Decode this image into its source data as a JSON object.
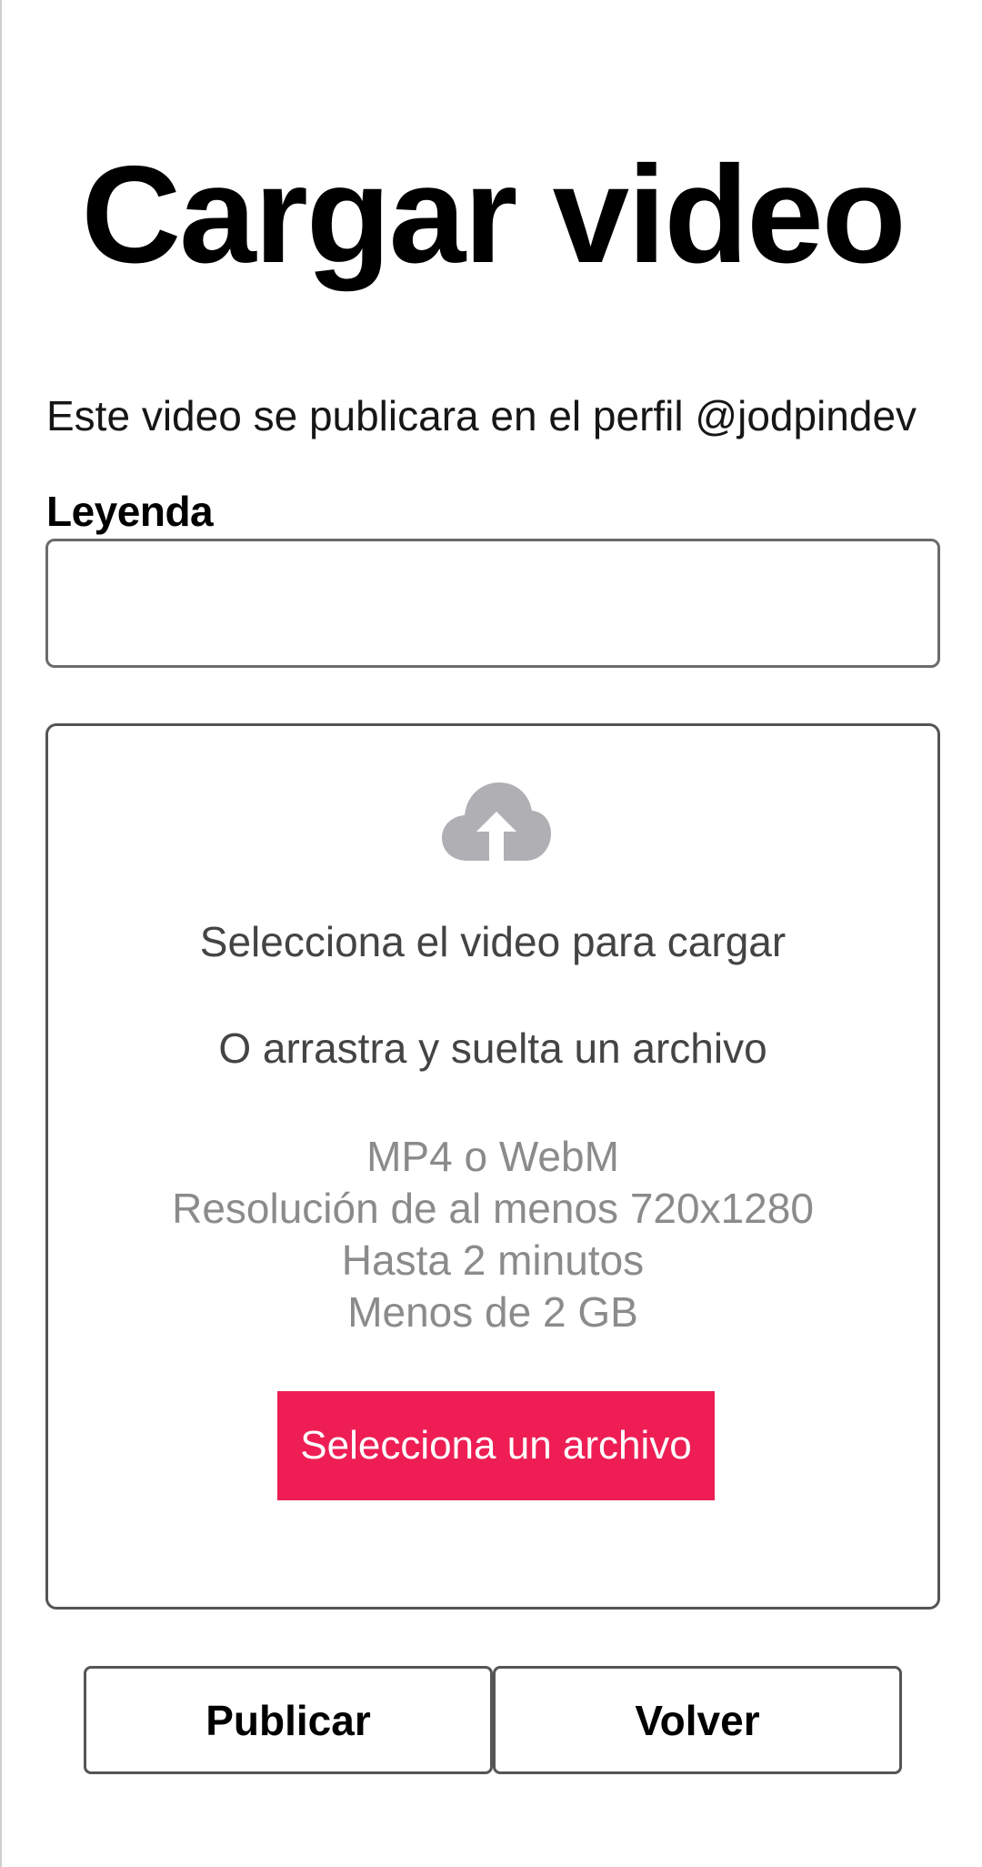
{
  "header": {
    "title": "Cargar video"
  },
  "profile_note": "Este video se publicara en el perfil @jodpindev",
  "caption": {
    "label": "Leyenda",
    "value": "",
    "placeholder": ""
  },
  "dropzone": {
    "icon": "cloud-upload-icon",
    "primary_text": "Selecciona el video para cargar",
    "secondary_text": "O arrastra y suelta un archivo",
    "specs": [
      "MP4 o WebM",
      "Resolución de al menos 720x1280",
      "Hasta 2 minutos",
      "Menos de 2 GB"
    ],
    "button_label": "Selecciona un archivo"
  },
  "actions": {
    "publish_label": "Publicar",
    "back_label": "Volver"
  },
  "colors": {
    "accent": "#ee1e55",
    "icon_gray": "#b0b0b4",
    "spec_text": "#8b8b8b",
    "body_text": "#444444",
    "border": "#555555"
  }
}
